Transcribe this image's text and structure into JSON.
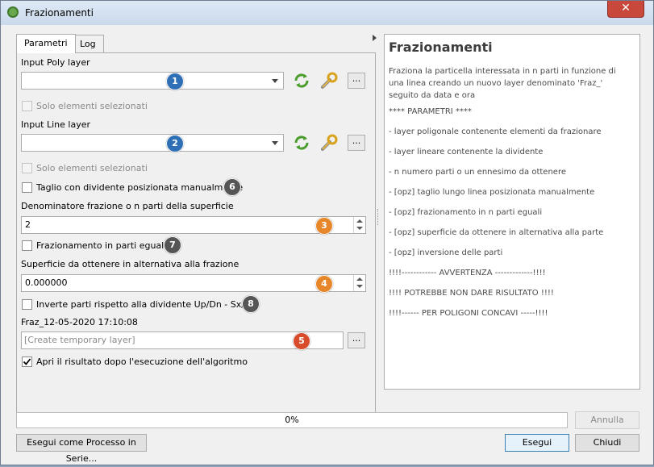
{
  "window": {
    "title": "Frazionamenti",
    "close_glyph": "✕"
  },
  "tabs": [
    {
      "label": "Parametri"
    },
    {
      "label": "Log"
    }
  ],
  "params": {
    "poly_layer_label": "Input Poly layer",
    "poly_selected_only": "Solo elementi selezionati",
    "line_layer_label": "Input Line layer",
    "line_selected_only": "Solo elementi selezionati",
    "manual_cut_label": "Taglio con dividente posizionata manualmente",
    "denominator_label": "Denominatore frazione o n parti della superficie",
    "denominator_value": "2",
    "equal_parts_label": "Frazionamento in parti eguali",
    "area_label": "Superficie da ottenere in alternativa alla frazione",
    "area_value": "0.000000",
    "invert_label": "Inverte parti rispetto alla dividente Up/Dn - Sx/dx",
    "output_label": "Fraz_12-05-2020 17:10:08",
    "output_placeholder": "[Create temporary layer]",
    "open_result_label": "Apri il risultato dopo l'esecuzione dell'algoritmo",
    "dots": "..."
  },
  "badges": [
    "1",
    "2",
    "3",
    "4",
    "5",
    "6",
    "7",
    "8"
  ],
  "help": {
    "title": "Frazionamenti",
    "intro": "Fraziona la particella interessata in n parti in funzione di una linea creando un nuovo layer denominato 'Fraz_' seguito da data e ora",
    "lines": [
      "**** PARAMETRI ****",
      "- layer poligonale contenente elementi da frazionare",
      "- layer lineare contenente la dividente",
      "- n numero parti o un ennesimo da ottenere",
      "- [opz] taglio lungo linea posizionata manualmente",
      "- [opz] frazionamento in n parti eguali",
      "- [opz] superficie da ottenere in alternativa alla parte",
      "- [opz] inversione delle parti",
      "!!!!------------ AVVERTENZA -------------!!!!",
      "!!!! POTREBBE NON DARE RISULTATO !!!!",
      "!!!!------ PER POLIGONI CONCAVI -----!!!!"
    ]
  },
  "progress": {
    "text": "0%",
    "value": 0
  },
  "buttons": {
    "annulla": "Annulla",
    "batch": "Esegui come Processo in Serie...",
    "esegui": "Esegui",
    "chiudi": "Chiudi"
  },
  "colors": {
    "badge_blue": "#2e6fb6",
    "badge_orange": "#e8862a",
    "badge_red": "#d84c2c",
    "badge_grey": "#555555"
  },
  "icons": [
    "qgis-logo-icon",
    "refresh-icon",
    "wrench-icon",
    "chevron-down-icon",
    "checkmark-icon",
    "expand-arrow-icon"
  ]
}
